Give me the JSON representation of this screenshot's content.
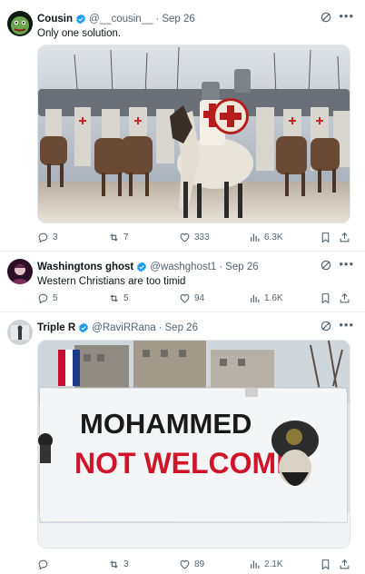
{
  "tweets": [
    {
      "name": "Cousin",
      "handle": "@__cousin__",
      "time": "Sep 26",
      "text": "Only one solution.",
      "replies": "3",
      "reposts": "7",
      "likes": "333",
      "views": "6.3K",
      "repost_color": "#536471"
    },
    {
      "name": "Washingtons ghost",
      "handle": "@washghost1",
      "time": "Sep 26",
      "text": "Western Christians are too timid",
      "replies": "5",
      "reposts": "5",
      "likes": "94",
      "views": "1.6K"
    },
    {
      "name": "Triple R",
      "handle": "@RaviRRana",
      "time": "Sep 26",
      "text": "",
      "banner_line1": "MOHAMMED",
      "banner_line2": "NOT WELCOME",
      "replies": "",
      "reposts": "3",
      "likes": "89",
      "views": "2.1K"
    }
  ],
  "colors": {
    "accent": "#1d9bf0",
    "muted": "#536471",
    "banner_red": "#d0152b"
  },
  "icons": [
    "verified-badge-icon",
    "grok-icon",
    "more-icon",
    "reply-icon",
    "repost-icon",
    "like-icon",
    "views-icon",
    "bookmark-icon",
    "share-icon"
  ]
}
